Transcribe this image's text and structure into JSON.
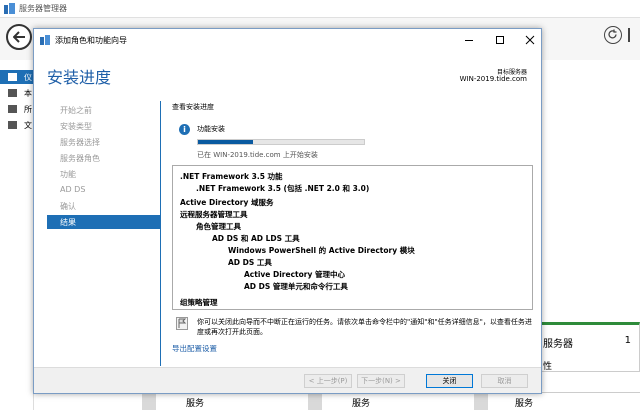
{
  "server_manager": {
    "title": "服务器管理器",
    "nav": [
      {
        "label": "仪"
      },
      {
        "label": "本"
      },
      {
        "label": "所"
      },
      {
        "label": "文"
      }
    ],
    "tile": {
      "label": "服务器",
      "count": "1",
      "sub": "性"
    },
    "bottom_cells": [
      "服务",
      "服务",
      "服务"
    ]
  },
  "wizard": {
    "title": "添加角色和功能向导",
    "heading": "安装进度",
    "target_label": "目标服务器",
    "target_server": "WIN-2019.tide.com",
    "steps": [
      {
        "label": "开始之前",
        "current": false
      },
      {
        "label": "安装类型",
        "current": false
      },
      {
        "label": "服务器选择",
        "current": false
      },
      {
        "label": "服务器角色",
        "current": false
      },
      {
        "label": "功能",
        "current": false
      },
      {
        "label": "AD DS",
        "current": false
      },
      {
        "label": "确认",
        "current": false
      },
      {
        "label": "结果",
        "current": true
      }
    ],
    "section_title": "查看安装进度",
    "status_label": "功能安装",
    "progress_fraction": 0.33,
    "progress_text": "已在 WIN-2019.tide.com 上开始安装",
    "results": [
      {
        "text": ".NET Framework 3.5 功能",
        "level": 0
      },
      {
        "text": ".NET Framework 3.5 (包括 .NET 2.0 和 3.0)",
        "level": 1
      },
      {
        "text": "Active Directory 域服务",
        "level": 0
      },
      {
        "text": "远程服务器管理工具",
        "level": 0
      },
      {
        "text": "角色管理工具",
        "level": 1
      },
      {
        "text": "AD DS 和 AD LDS 工具",
        "level": 2
      },
      {
        "text": "Windows PowerShell 的 Active Directory 模块",
        "level": 3
      },
      {
        "text": "AD DS 工具",
        "level": 3
      },
      {
        "text": "Active Directory 管理中心",
        "level": 4
      },
      {
        "text": "AD DS 管理单元和命令行工具",
        "level": 4
      },
      {
        "text": "组策略管理",
        "level": 0
      }
    ],
    "note": "你可以关闭此向导而不中断正在运行的任务。请依次单击命令栏中的\"通知\"和\"任务详细信息\"，以查看任务进度或再次打开此页面。",
    "export_link": "导出配置设置",
    "buttons": {
      "prev": "< 上一步(P)",
      "next": "下一步(N) >",
      "close": "关闭",
      "cancel": "取消"
    }
  }
}
